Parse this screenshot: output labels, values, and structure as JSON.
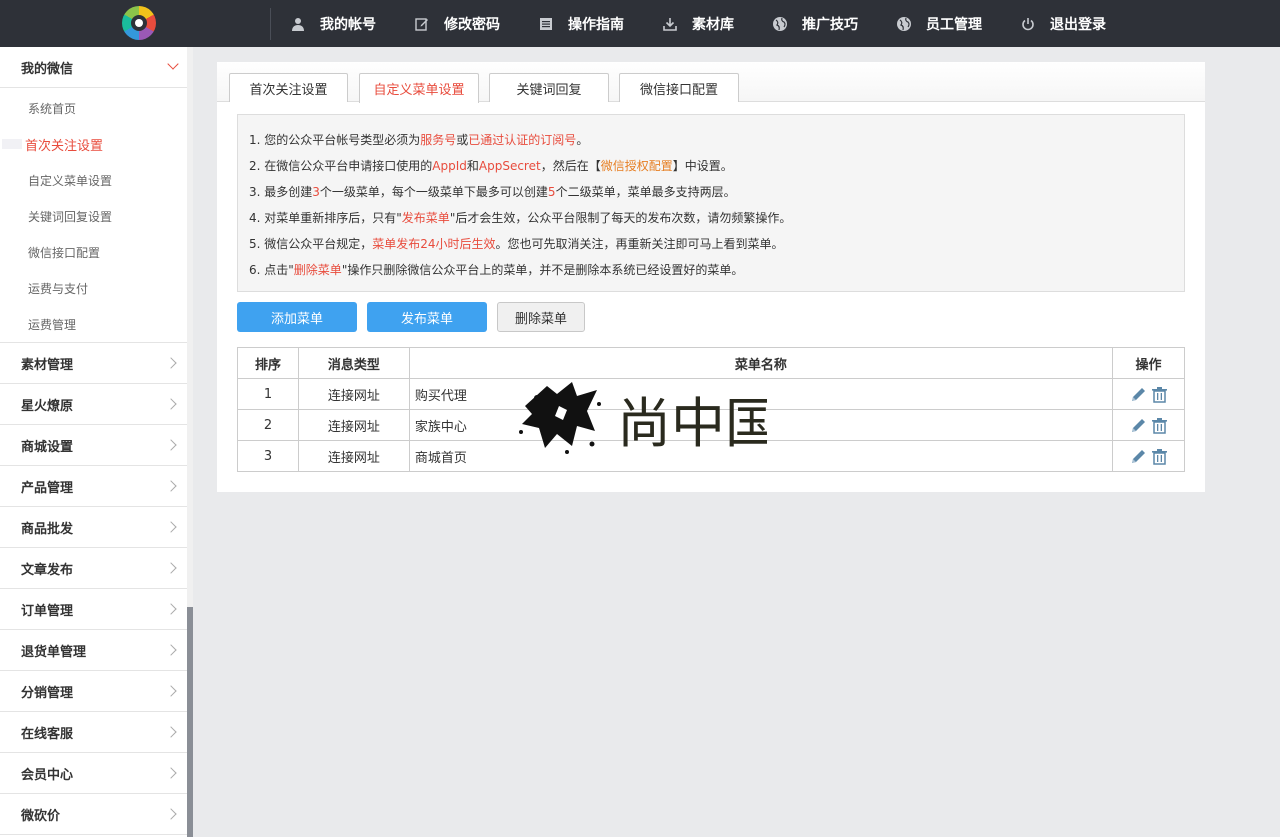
{
  "topbar": {
    "nav": [
      {
        "icon": "user-icon",
        "label": "我的帐号"
      },
      {
        "icon": "edit-icon",
        "label": "修改密码"
      },
      {
        "icon": "book-icon",
        "label": "操作指南"
      },
      {
        "icon": "download-icon",
        "label": "素材库"
      },
      {
        "icon": "globe-icon",
        "label": "推广技巧"
      },
      {
        "icon": "globe-icon",
        "label": "员工管理"
      },
      {
        "icon": "power-icon",
        "label": "退出登录"
      }
    ]
  },
  "sidebar": {
    "open_group": {
      "label": "我的微信",
      "items": [
        "系统首页",
        "首次关注设置",
        "自定义菜单设置",
        "关键词回复设置",
        "微信接口配置",
        "运费与支付",
        "运费管理"
      ],
      "active_index": 1
    },
    "groups": [
      "素材管理",
      "星火燎原",
      "商城设置",
      "产品管理",
      "商品批发",
      "文章发布",
      "订单管理",
      "退货单管理",
      "分销管理",
      "在线客服",
      "会员中心",
      "微砍价"
    ]
  },
  "tabs": [
    {
      "label": "首次关注设置",
      "active": false
    },
    {
      "label": "自定义菜单设置",
      "active": true
    },
    {
      "label": "关键词回复",
      "active": false
    },
    {
      "label": "微信接口配置",
      "active": false
    }
  ],
  "notice": {
    "l1": {
      "a": "1. 您的公众平台帐号类型必须为",
      "b": "服务号",
      "c": "或",
      "d": "已通过认证的订阅号",
      "e": "。"
    },
    "l2": {
      "a": "2. 在微信公众平台申请接口使用的",
      "b": "AppId",
      "c": "和",
      "d": "AppSecret",
      "e": "，然后在【",
      "f": "微信授权配置",
      "g": "】中设置。"
    },
    "l3": {
      "a": "3. 最多创建",
      "b": "3",
      "c": "个一级菜单，每个一级菜单下最多可以创建",
      "d": "5",
      "e": "个二级菜单，菜单最多支持两层。"
    },
    "l4": {
      "a": "4. 对菜单重新排序后，只有\"",
      "b": "发布菜单",
      "c": "\"后才会生效，公众平台限制了每天的发布次数，请勿频繁操作。"
    },
    "l5": {
      "a": "5. 微信公众平台规定，",
      "b": "菜单发布24小时后生效",
      "c": "。您也可先取消关注，再重新关注即可马上看到菜单。"
    },
    "l6": {
      "a": "6. 点击\"",
      "b": "删除菜单",
      "c": "\"操作只删除微信公众平台上的菜单，并不是删除本系统已经设置好的菜单。"
    }
  },
  "buttons": {
    "add": "添加菜单",
    "publish": "发布菜单",
    "delete": "删除菜单"
  },
  "table": {
    "headers": [
      "排序",
      "消息类型",
      "菜单名称",
      "操作"
    ],
    "rows": [
      {
        "order": "1",
        "type": "连接网址",
        "name": "购买代理"
      },
      {
        "order": "2",
        "type": "连接网址",
        "name": "家族中心"
      },
      {
        "order": "3",
        "type": "连接网址",
        "name": "商城首页"
      }
    ]
  },
  "watermark": {
    "text": "尚中国"
  },
  "colors": {
    "accent": "#e84c3d",
    "button_blue": "#3fa2f0",
    "topbar": "#2e3138"
  }
}
